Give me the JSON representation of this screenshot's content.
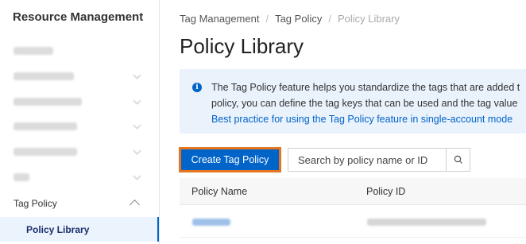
{
  "sidebar": {
    "title": "Resource Management",
    "items": [
      {
        "label": "Overview",
        "obscured": true
      },
      {
        "label": "Resource Center",
        "obscured": true
      },
      {
        "label": "Resource Directory",
        "obscured": true
      },
      {
        "label": "Resource Sharing",
        "obscured": true
      },
      {
        "label": "Resource Group",
        "obscured": true
      },
      {
        "label": "Tag",
        "obscured": true
      },
      {
        "label": "Tag Policy",
        "expanded": true
      },
      {
        "label": "Policy Library",
        "active": true
      }
    ]
  },
  "breadcrumb": [
    "Tag Management",
    "Tag Policy",
    "Policy Library"
  ],
  "page_title": "Policy Library",
  "info": {
    "line1": "The Tag Policy feature helps you standardize the tags that are added t",
    "line2": "policy, you can define the tag keys that can be used and the tag value",
    "link": "Best practice for using the Tag Policy feature in single-account mode"
  },
  "toolbar": {
    "create_label": "Create Tag Policy",
    "search_placeholder": "Search by policy name or ID"
  },
  "table": {
    "columns": [
      "Policy Name",
      "Policy ID"
    ],
    "rows": [
      {
        "policy_name": "example",
        "policy_id": "p-obscured",
        "obscured": true
      }
    ]
  },
  "colors": {
    "accent": "#0064c8",
    "highlight_border": "#e5751f",
    "info_bg": "#eaf2fc"
  }
}
